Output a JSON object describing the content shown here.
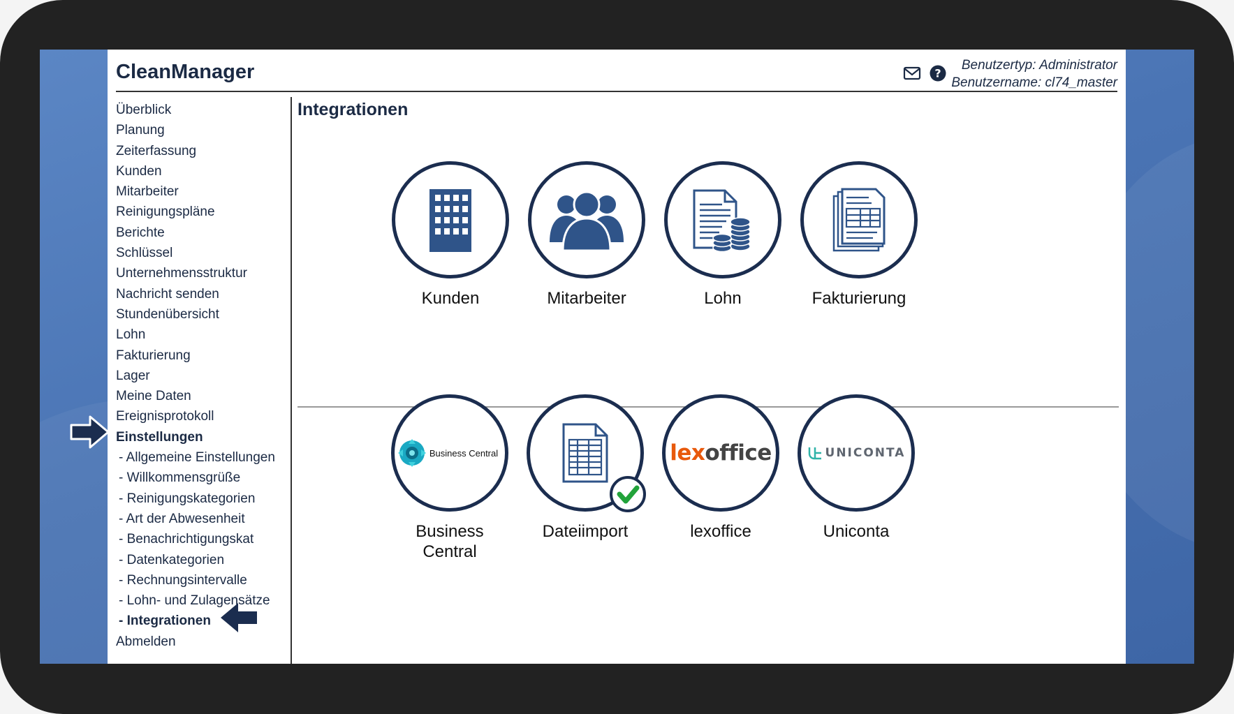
{
  "app": {
    "title": "CleanManager",
    "user_type": "Benutzertyp: Administrator",
    "user_name": "Benutzername: cl74_master"
  },
  "icons": {
    "mail": "mail-icon",
    "help": "help-icon"
  },
  "sidebar": {
    "items": [
      {
        "label": "Überblick"
      },
      {
        "label": "Planung"
      },
      {
        "label": "Zeiterfassung"
      },
      {
        "label": "Kunden"
      },
      {
        "label": "Mitarbeiter"
      },
      {
        "label": "Reinigungspläne"
      },
      {
        "label": "Berichte"
      },
      {
        "label": "Schlüssel"
      },
      {
        "label": "Unternehmensstruktur"
      },
      {
        "label": "Nachricht senden"
      },
      {
        "label": "Stundenübersicht"
      },
      {
        "label": "Lohn"
      },
      {
        "label": "Fakturierung"
      },
      {
        "label": "Lager"
      },
      {
        "label": "Meine Daten"
      },
      {
        "label": "Ereignisprotokoll"
      },
      {
        "label": "Einstellungen"
      },
      {
        "label": "- Allgemeine Einstellungen"
      },
      {
        "label": "- Willkommensgrüße"
      },
      {
        "label": "- Reinigungskategorien"
      },
      {
        "label": "- Art der Abwesenheit"
      },
      {
        "label": "- Benachrichtigungskat"
      },
      {
        "label": "- Datenkategorien"
      },
      {
        "label": "- Rechnungsintervalle"
      },
      {
        "label": "- Lohn- und Zulagensätze"
      },
      {
        "label": "- Integrationen"
      },
      {
        "label": "Abmelden"
      }
    ]
  },
  "main": {
    "title": "Integrationen",
    "top_tiles": [
      {
        "label": "Kunden",
        "icon": "building-icon"
      },
      {
        "label": "Mitarbeiter",
        "icon": "people-icon"
      },
      {
        "label": "Lohn",
        "icon": "payroll-icon"
      },
      {
        "label": "Fakturierung",
        "icon": "invoice-icon"
      }
    ],
    "bottom_tiles": [
      {
        "label": "Business Central",
        "logo_text": "Business Central",
        "icon": "business-central-logo-icon"
      },
      {
        "label": "Dateiimport",
        "icon": "spreadsheet-icon",
        "status": "active"
      },
      {
        "label": "lexoffice",
        "logo_lex": "lex",
        "logo_office": "office"
      },
      {
        "label": "Uniconta",
        "logo_text": "UNICONTA"
      }
    ]
  },
  "colors": {
    "navy": "#1b2d4f",
    "icon_blue": "#2f5489",
    "check_green": "#22a33a",
    "lex_orange": "#e8590c"
  }
}
